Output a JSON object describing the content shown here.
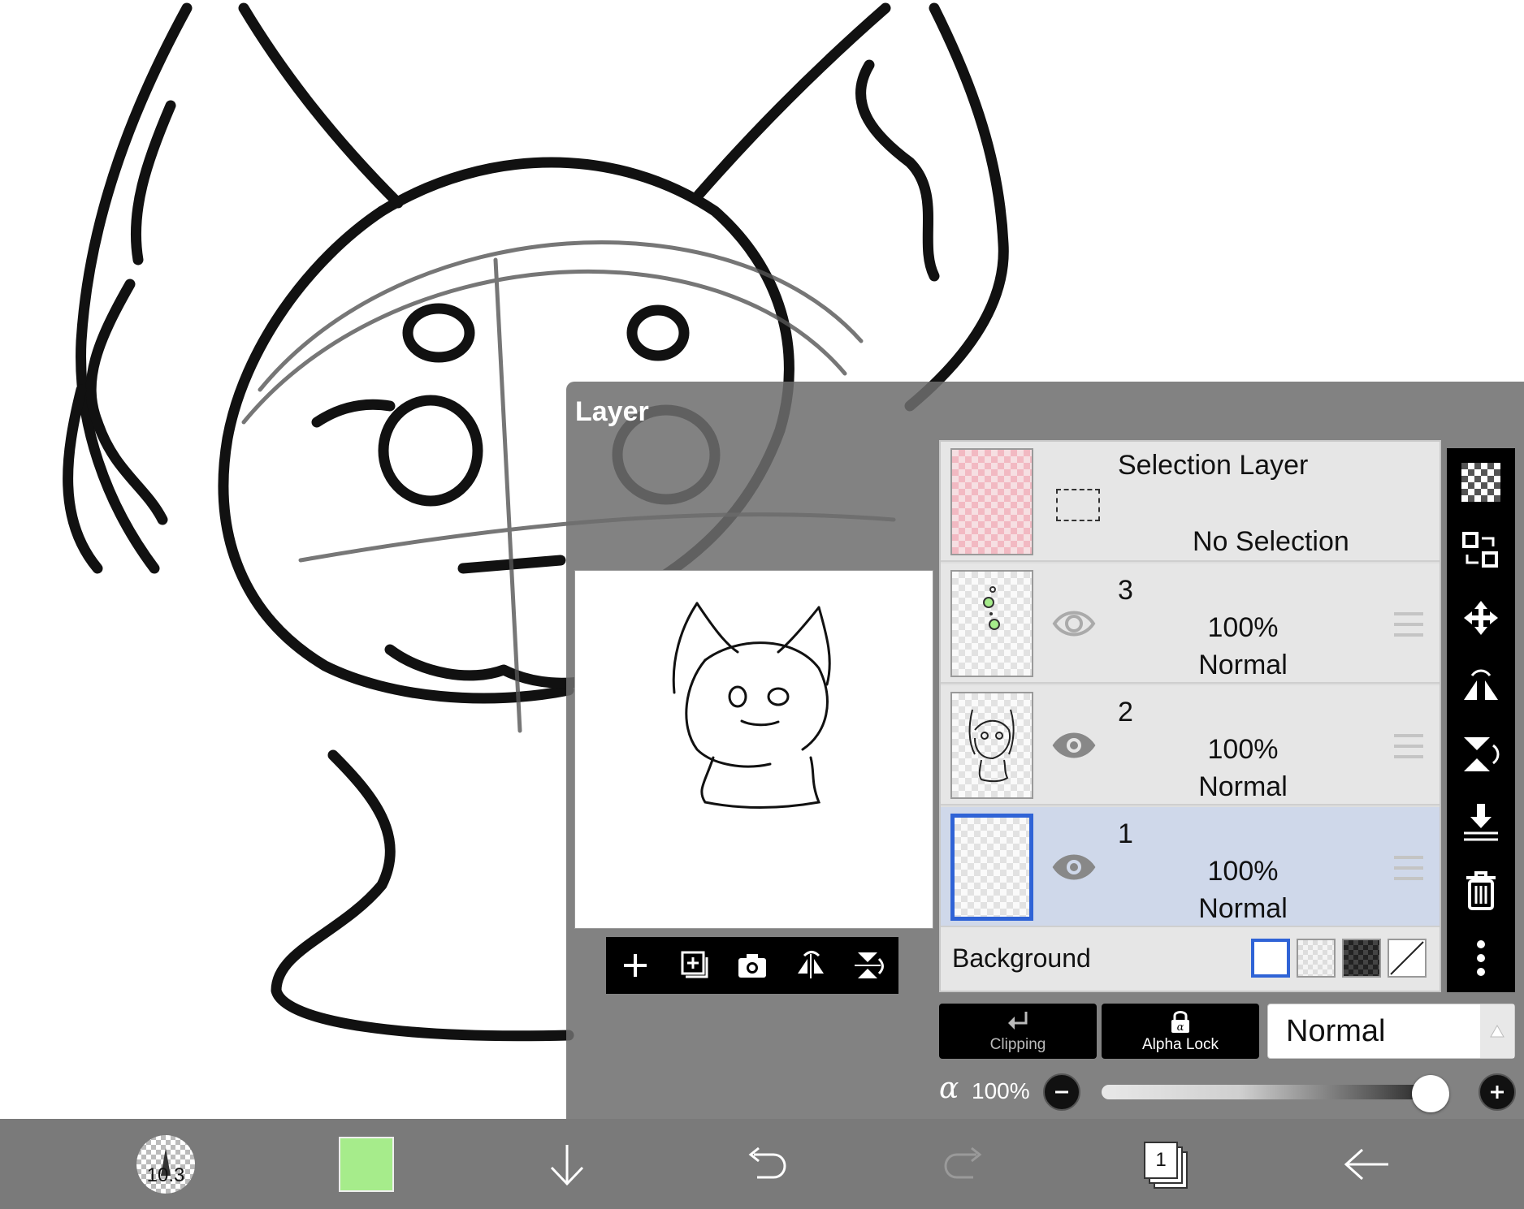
{
  "layer_panel": {
    "title": "Layer",
    "selection_layer": {
      "name": "Selection Layer",
      "status": "No Selection"
    },
    "layers": [
      {
        "name": "3",
        "opacity": "100%",
        "blend": "Normal",
        "visible": true,
        "selected": false
      },
      {
        "name": "2",
        "opacity": "100%",
        "blend": "Normal",
        "visible": true,
        "selected": false
      },
      {
        "name": "1",
        "opacity": "100%",
        "blend": "Normal",
        "visible": true,
        "selected": true
      }
    ],
    "background_label": "Background",
    "clipping_label": "Clipping",
    "alpha_lock_label": "Alpha Lock",
    "blend_mode": "Normal",
    "alpha_symbol": "α",
    "alpha_value": "100%",
    "alpha_fraction": 1.0
  },
  "bottom_bar": {
    "brush_size": "10.3",
    "color": "#a6ec8b",
    "layer_count": "1"
  },
  "colors": {
    "selection_highlight": "#2f63d6",
    "selected_row": "#cfd8ea",
    "accent_green": "#a6ec8b"
  }
}
